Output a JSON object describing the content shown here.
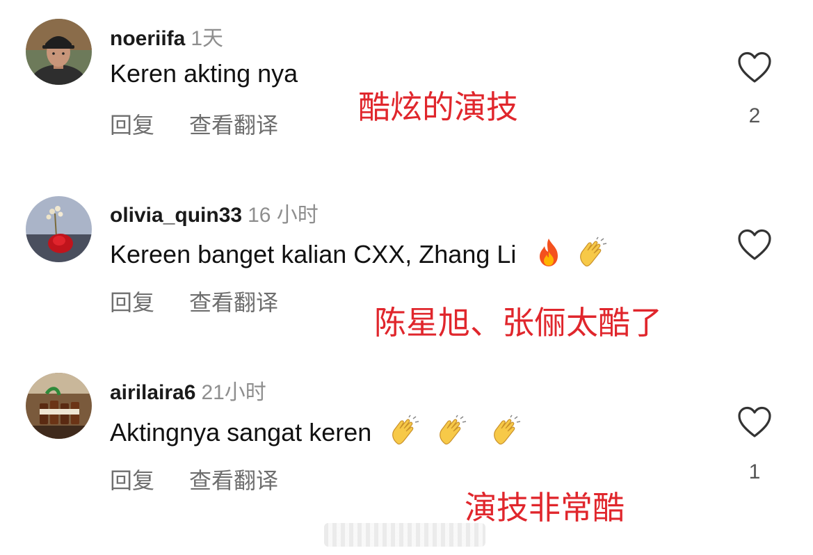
{
  "comments": [
    {
      "username": "noeriifa",
      "time": "1天",
      "text": "Keren akting nya",
      "emojis": [],
      "reply_label": "回复",
      "translate_label": "查看翻译",
      "like_count": "2",
      "annotation": "酷炫的演技"
    },
    {
      "username": "olivia_quin33",
      "time": "16 小时",
      "text": "Kereen banget kalian CXX, Zhang Li",
      "emojis": [
        "fire-emoji",
        "clapping-hands-emoji"
      ],
      "reply_label": "回复",
      "translate_label": "查看翻译",
      "like_count": "",
      "annotation": "陈星旭、张俪太酷了"
    },
    {
      "username": "airilaira6",
      "time": "21小时",
      "text": "Aktingnya sangat keren",
      "emojis": [
        "clapping-hands-emoji",
        "clapping-hands-emoji",
        "clapping-hands-emoji"
      ],
      "reply_label": "回复",
      "translate_label": "查看翻译",
      "like_count": "1",
      "annotation": "演技非常酷"
    }
  ],
  "colors": {
    "annotation": "#e0262c",
    "secondary_text": "#8e8e8e",
    "primary_text": "#111111"
  }
}
